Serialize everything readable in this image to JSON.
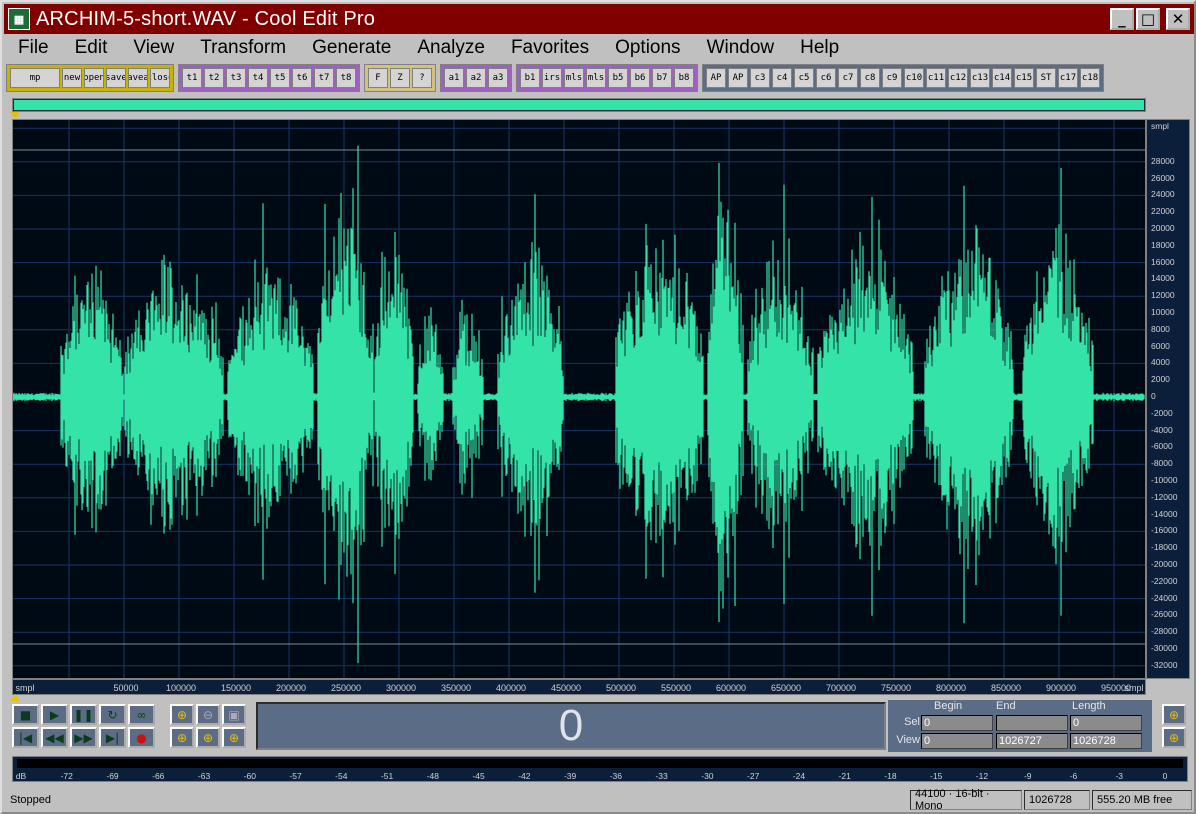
{
  "window": {
    "title": "ARCHIM-5-short.WAV - Cool Edit Pro",
    "minimize_glyph": "_",
    "maximize_glyph": "□",
    "close_glyph": "✕"
  },
  "menu": [
    {
      "label": "File"
    },
    {
      "label": "Edit"
    },
    {
      "label": "View"
    },
    {
      "label": "Transform"
    },
    {
      "label": "Generate"
    },
    {
      "label": "Analyze"
    },
    {
      "label": "Favorites"
    },
    {
      "label": "Options"
    },
    {
      "label": "Window"
    },
    {
      "label": "Help"
    }
  ],
  "toolbar_groups": [
    {
      "bg": "#c8b400",
      "buttons": [
        "mp",
        "new",
        "open",
        "save",
        "saveas",
        "close"
      ]
    },
    {
      "bg": "#a060c0",
      "buttons": [
        "t1",
        "t2",
        "t3",
        "t4",
        "t5",
        "t6",
        "t7",
        "t8"
      ]
    },
    {
      "bg": "#d4c080",
      "buttons": [
        "F",
        "Z",
        "?"
      ]
    },
    {
      "bg": "#a060c0",
      "buttons": [
        "a1",
        "a2",
        "a3"
      ]
    },
    {
      "bg": "#a060c0",
      "buttons": [
        "b1",
        "irs",
        "mls",
        "mls",
        "b5",
        "b6",
        "b7",
        "b8"
      ]
    },
    {
      "bg": "#5a6c86",
      "buttons": [
        "AP",
        "AP",
        "c3",
        "c4",
        "c5",
        "c6",
        "c7",
        "c8",
        "c9",
        "c10",
        "c11",
        "c12",
        "c13",
        "c14",
        "c15",
        "ST",
        "c17",
        "c18"
      ]
    }
  ],
  "waveform": {
    "color": "#33e3a8",
    "background": "#000a14",
    "grid_color": "#1a3566"
  },
  "y_axis": {
    "unit_label": "smpl",
    "ticks": [
      "28000",
      "26000",
      "24000",
      "22000",
      "20000",
      "18000",
      "16000",
      "14000",
      "12000",
      "10000",
      "8000",
      "6000",
      "4000",
      "2000",
      "0",
      "-2000",
      "-4000",
      "-6000",
      "-8000",
      "-10000",
      "-12000",
      "-14000",
      "-16000",
      "-18000",
      "-20000",
      "-22000",
      "-24000",
      "-26000",
      "-28000",
      "-30000",
      "-32000"
    ]
  },
  "x_axis": {
    "unit_left": "smpl",
    "unit_right": "smpl",
    "ticks": [
      "50000",
      "100000",
      "150000",
      "200000",
      "250000",
      "300000",
      "350000",
      "400000",
      "450000",
      "500000",
      "550000",
      "600000",
      "650000",
      "700000",
      "750000",
      "800000",
      "850000",
      "900000",
      "950000"
    ]
  },
  "transport": {
    "stop": "■",
    "play": "▶",
    "pause": "❚❚",
    "play_looped": "↻",
    "loop": "∞",
    "go_begin": "|◀",
    "rewind": "◀◀",
    "forward": "▶▶",
    "go_end": "▶|",
    "record": "●"
  },
  "zoom": {
    "zoom_in": "⊕",
    "zoom_out": "⊖",
    "zoom_full": "▣",
    "zoom_sel": "⊕",
    "zoom_left": "⊕",
    "zoom_right": "⊕",
    "v_zoom_in": "⊕",
    "v_zoom_out": "⊕"
  },
  "time_display": "0",
  "selection": {
    "headers": {
      "begin": "Begin",
      "end": "End",
      "length": "Length"
    },
    "sel": {
      "label": "Sel",
      "begin": "0",
      "end": "",
      "length": "0"
    },
    "view": {
      "label": "View",
      "begin": "0",
      "end": "1026727",
      "length": "1026728"
    }
  },
  "level_meter": {
    "ticks": [
      "dB",
      "-72",
      "-69",
      "-66",
      "-63",
      "-60",
      "-57",
      "-54",
      "-51",
      "-48",
      "-45",
      "-42",
      "-39",
      "-36",
      "-33",
      "-30",
      "-27",
      "-24",
      "-21",
      "-18",
      "-15",
      "-12",
      "-9",
      "-6",
      "-3",
      "0"
    ]
  },
  "status": {
    "state": "Stopped",
    "format": "44100 · 16-bit · Mono",
    "size": "1026728",
    "free": "555.20 MB free"
  }
}
